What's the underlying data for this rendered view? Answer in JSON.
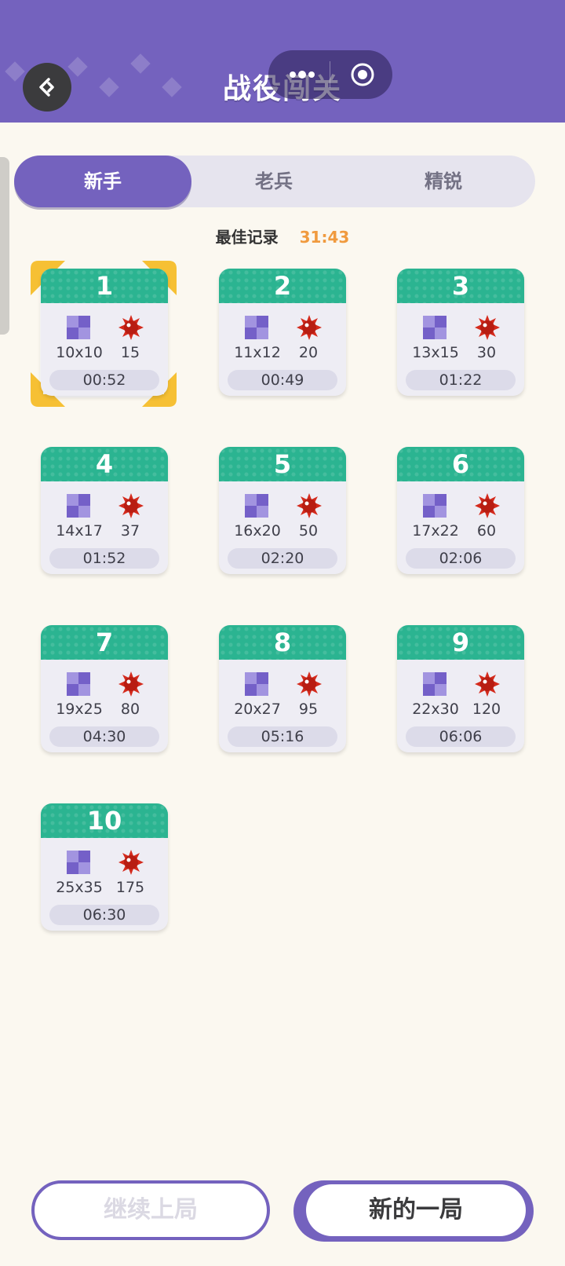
{
  "header": {
    "title": "战役闯关"
  },
  "tabs": [
    {
      "label": "新手",
      "active": true
    },
    {
      "label": "老兵",
      "active": false
    },
    {
      "label": "精锐",
      "active": false
    }
  ],
  "best_record": {
    "label": "最佳记录",
    "time": "31:43"
  },
  "levels": [
    {
      "number": "1",
      "size": "10x10",
      "mines": "15",
      "time": "00:52",
      "selected": true
    },
    {
      "number": "2",
      "size": "11x12",
      "mines": "20",
      "time": "00:49"
    },
    {
      "number": "3",
      "size": "13x15",
      "mines": "30",
      "time": "01:22"
    },
    {
      "number": "4",
      "size": "14x17",
      "mines": "37",
      "time": "01:52"
    },
    {
      "number": "5",
      "size": "16x20",
      "mines": "50",
      "time": "02:20"
    },
    {
      "number": "6",
      "size": "17x22",
      "mines": "60",
      "time": "02:06"
    },
    {
      "number": "7",
      "size": "19x25",
      "mines": "80",
      "time": "04:30"
    },
    {
      "number": "8",
      "size": "20x27",
      "mines": "95",
      "time": "05:16"
    },
    {
      "number": "9",
      "size": "22x30",
      "mines": "120",
      "time": "06:06"
    },
    {
      "number": "10",
      "size": "25x35",
      "mines": "175",
      "time": "06:30"
    }
  ],
  "buttons": {
    "continue_label": "继续上局",
    "new_game_label": "新的一局"
  },
  "colors": {
    "primary": "#7462be",
    "card_header": "#2bb491",
    "best_time": "#f09a3e",
    "selection": "#f6c034",
    "mine": "#d42a1c"
  }
}
